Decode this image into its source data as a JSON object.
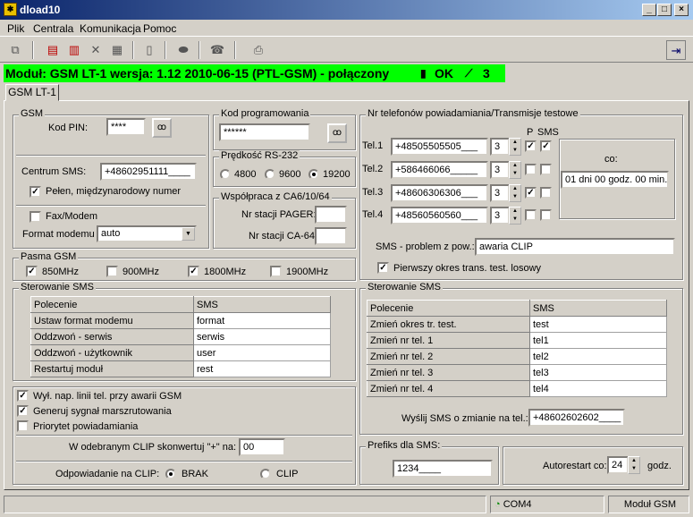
{
  "window": {
    "title": "dload10",
    "min": "_",
    "max": "□",
    "close": "×"
  },
  "menu": {
    "items": [
      "Plik",
      "Centrala",
      "Komunikacja",
      "Pomoc"
    ]
  },
  "status": {
    "text": "Moduł: GSM LT-1 wersja: 1.12 2010-06-15 (PTL-GSM) -  połączony",
    "ok": "OK",
    "signal": "3",
    "bg": "#00ff00"
  },
  "tab": {
    "label": "GSM LT-1"
  },
  "gsm": {
    "title": "GSM",
    "pin_label": "Kod PIN:",
    "pin_value": "****",
    "centrum_label": "Centrum SMS:",
    "centrum_value": "+48602951111____",
    "intl_label": "Pełen, międzynarodowy numer",
    "fax_label": "Fax/Modem",
    "format_label": "Format modemu",
    "format_value": "auto"
  },
  "kod": {
    "title": "Kod programowania",
    "value": "******"
  },
  "rs232": {
    "title": "Prędkość RS-232",
    "options": [
      "4800",
      "9600",
      "19200"
    ],
    "selected": "19200"
  },
  "ca": {
    "title": "Współpraca z CA6/10/64",
    "pager_label": "Nr stacji PAGER:",
    "pager_value": "",
    "ca64_label": "Nr stacji CA-64:",
    "ca64_value": ""
  },
  "phones": {
    "title": "Nr telefonów powiadamiania/Transmisje testowe",
    "p_label": "P",
    "sms_label": "SMS",
    "rows": [
      {
        "label": "Tel.1",
        "number": "+48505505505___",
        "n": "3",
        "p": true,
        "sms": true
      },
      {
        "label": "Tel.2",
        "number": "+586466066_____",
        "n": "3",
        "p": false,
        "sms": false
      },
      {
        "label": "Tel.3",
        "number": "+48606306306___",
        "n": "3",
        "p": true,
        "sms": false
      },
      {
        "label": "Tel.4",
        "number": "+48560560560___",
        "n": "3",
        "p": false,
        "sms": false
      }
    ],
    "co_label": "co:",
    "co_value": "01 dni 00 godz. 00 min.",
    "problem_label": "SMS - problem z pow.:",
    "problem_value": "awaria CLIP",
    "random_label": "Pierwszy okres trans. test. losowy"
  },
  "pasma": {
    "title": "Pasma GSM",
    "bands": [
      {
        "label": "850MHz",
        "checked": true
      },
      {
        "label": "900MHz",
        "checked": false
      },
      {
        "label": "1800MHz",
        "checked": true
      },
      {
        "label": "1900MHz",
        "checked": false
      }
    ]
  },
  "ster_left": {
    "title": "Sterowanie SMS",
    "headers": [
      "Polecenie",
      "SMS"
    ],
    "rows": [
      [
        "Ustaw format modemu",
        "format"
      ],
      [
        "Oddzwoń - serwis",
        "serwis"
      ],
      [
        "Oddzwoń - użytkownik",
        "user"
      ],
      [
        "Restartuj moduł",
        "rest"
      ]
    ]
  },
  "ster_right": {
    "title": "Sterowanie SMS",
    "headers": [
      "Polecenie",
      "SMS"
    ],
    "rows": [
      [
        "Zmień okres tr. test.",
        "test"
      ],
      [
        "Zmień nr tel. 1",
        "tel1"
      ],
      [
        "Zmień nr tel. 2",
        "tel2"
      ],
      [
        "Zmień nr tel. 3",
        "tel3"
      ],
      [
        "Zmień nr tel. 4",
        "tel4"
      ]
    ],
    "notify_label": "Wyślij SMS o zmianie na tel.:",
    "notify_value": "+48602602602____"
  },
  "options": {
    "items": [
      {
        "label": "Wył. nap. linii tel. przy awarii GSM",
        "checked": true
      },
      {
        "label": "Generuj sygnał marszrutowania",
        "checked": true
      },
      {
        "label": "Priorytet powiadamiania",
        "checked": false
      }
    ],
    "clip_convert_label": "W odebranym CLIP skonwertuj \"+\" na:",
    "clip_convert_value": "00",
    "answer_label": "Odpowiadanie na CLIP:",
    "answer_options": [
      "BRAK",
      "CLIP"
    ],
    "answer_selected": "BRAK"
  },
  "prefix": {
    "title": "Prefiks dla SMS:",
    "value": "1234____"
  },
  "autorestart": {
    "label": "Autorestart co:",
    "value": "24",
    "unit": "godz."
  },
  "bottom": {
    "port": "COM4",
    "module": "Moduł GSM"
  }
}
